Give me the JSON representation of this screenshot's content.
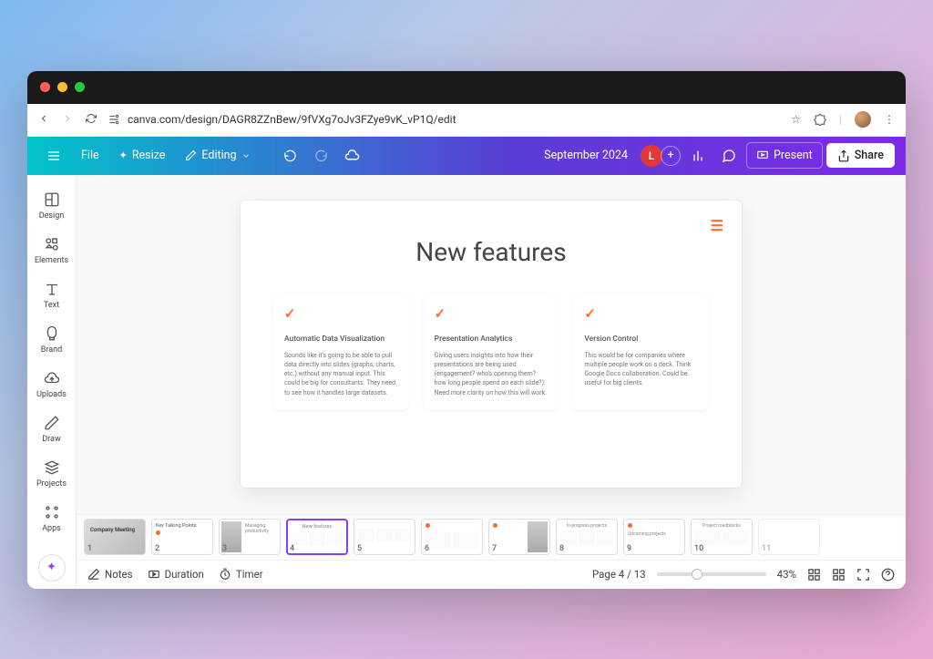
{
  "browser": {
    "url": "canva.com/design/DAGR8ZZnBew/9fVXg7oJv3FZye9vK_vP1Q/edit"
  },
  "toolbar": {
    "file": "File",
    "resize": "Resize",
    "editing": "Editing",
    "project_name": "September 2024",
    "avatar_letter": "L",
    "present": "Present",
    "share": "Share"
  },
  "sidebar": {
    "items": [
      {
        "label": "Design"
      },
      {
        "label": "Elements"
      },
      {
        "label": "Text"
      },
      {
        "label": "Brand"
      },
      {
        "label": "Uploads"
      },
      {
        "label": "Draw"
      },
      {
        "label": "Projects"
      },
      {
        "label": "Apps"
      }
    ]
  },
  "slide": {
    "title": "New features",
    "cards": [
      {
        "title": "Automatic Data Visualization",
        "body": "Sounds like it's going to be able to pull data directly into slides (graphs, charts, etc.) without any manual input. This could be big for consultants. They need to see how it handles large datasets."
      },
      {
        "title": "Presentation Analytics",
        "body": "Giving users insights into how their presentations are being used (engagement? who's opening them? how long people spend on each slide?). Need more clarity on how this will work."
      },
      {
        "title": "Version Control",
        "body": "This would be for companies where multiple people work on a deck. Think Google Docs collaboration. Could be useful for big clients."
      }
    ]
  },
  "thumbnails": [
    {
      "num": "1",
      "title": "Company Meeting"
    },
    {
      "num": "2",
      "title": "Key Talking Points"
    },
    {
      "num": "3",
      "title": "Managing productivity"
    },
    {
      "num": "4",
      "title": "New features"
    },
    {
      "num": "5",
      "title": ""
    },
    {
      "num": "6",
      "title": ""
    },
    {
      "num": "7",
      "title": ""
    },
    {
      "num": "8",
      "title": "In-progress projects"
    },
    {
      "num": "9",
      "title": "Upcoming projects"
    },
    {
      "num": "10",
      "title": "Project roadblocks"
    },
    {
      "num": "11",
      "title": ""
    }
  ],
  "footer": {
    "notes": "Notes",
    "duration": "Duration",
    "timer": "Timer",
    "page_indicator": "Page 4 / 13",
    "zoom": "43%"
  }
}
